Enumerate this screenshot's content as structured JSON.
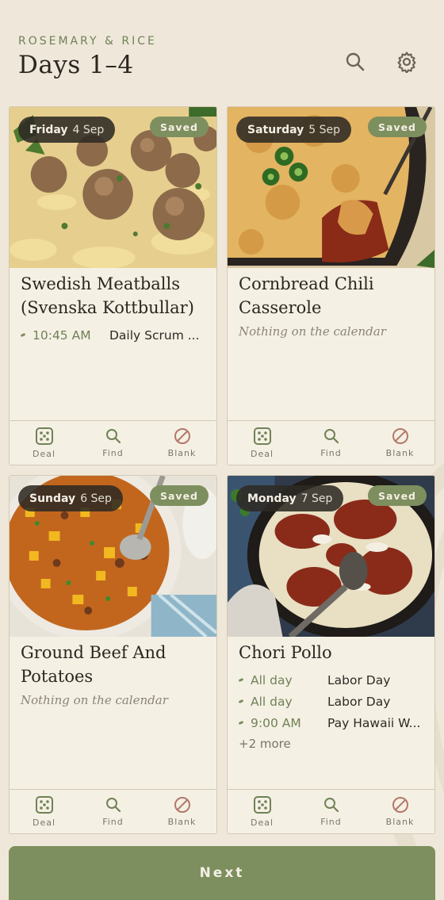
{
  "header": {
    "brand": "ROSEMARY & RICE",
    "title": "Days 1–4"
  },
  "actions": {
    "deal": "Deal",
    "find": "Find",
    "blank": "Blank"
  },
  "saved_label": "Saved",
  "cards": [
    {
      "dow": "Friday",
      "date": "4 Sep",
      "title": "Swedish Meatballs (Svenska Kottbullar)",
      "events": [
        {
          "time": "10:45 AM",
          "name": "Daily Scrum ..."
        }
      ],
      "empty": "",
      "more": ""
    },
    {
      "dow": "Saturday",
      "date": "5 Sep",
      "title": "Cornbread Chili Casserole",
      "events": [],
      "empty": "Nothing on the calendar",
      "more": ""
    },
    {
      "dow": "Sunday",
      "date": "6 Sep",
      "title": "Ground Beef And Potatoes",
      "events": [],
      "empty": "Nothing on the calendar",
      "more": ""
    },
    {
      "dow": "Monday",
      "date": "7 Sep",
      "title": "Chori Pollo",
      "events": [
        {
          "time": "All day",
          "name": "Labor Day"
        },
        {
          "time": "All day",
          "name": "Labor Day"
        },
        {
          "time": "9:00 AM",
          "name": "Pay Hawaii W..."
        }
      ],
      "empty": "",
      "more": "+2 more"
    }
  ],
  "next_label": "Next",
  "colors": {
    "accent": "#7e8f5f",
    "background": "#efe8da",
    "card": "#f5f0e4",
    "pill": "#2d2a24"
  }
}
